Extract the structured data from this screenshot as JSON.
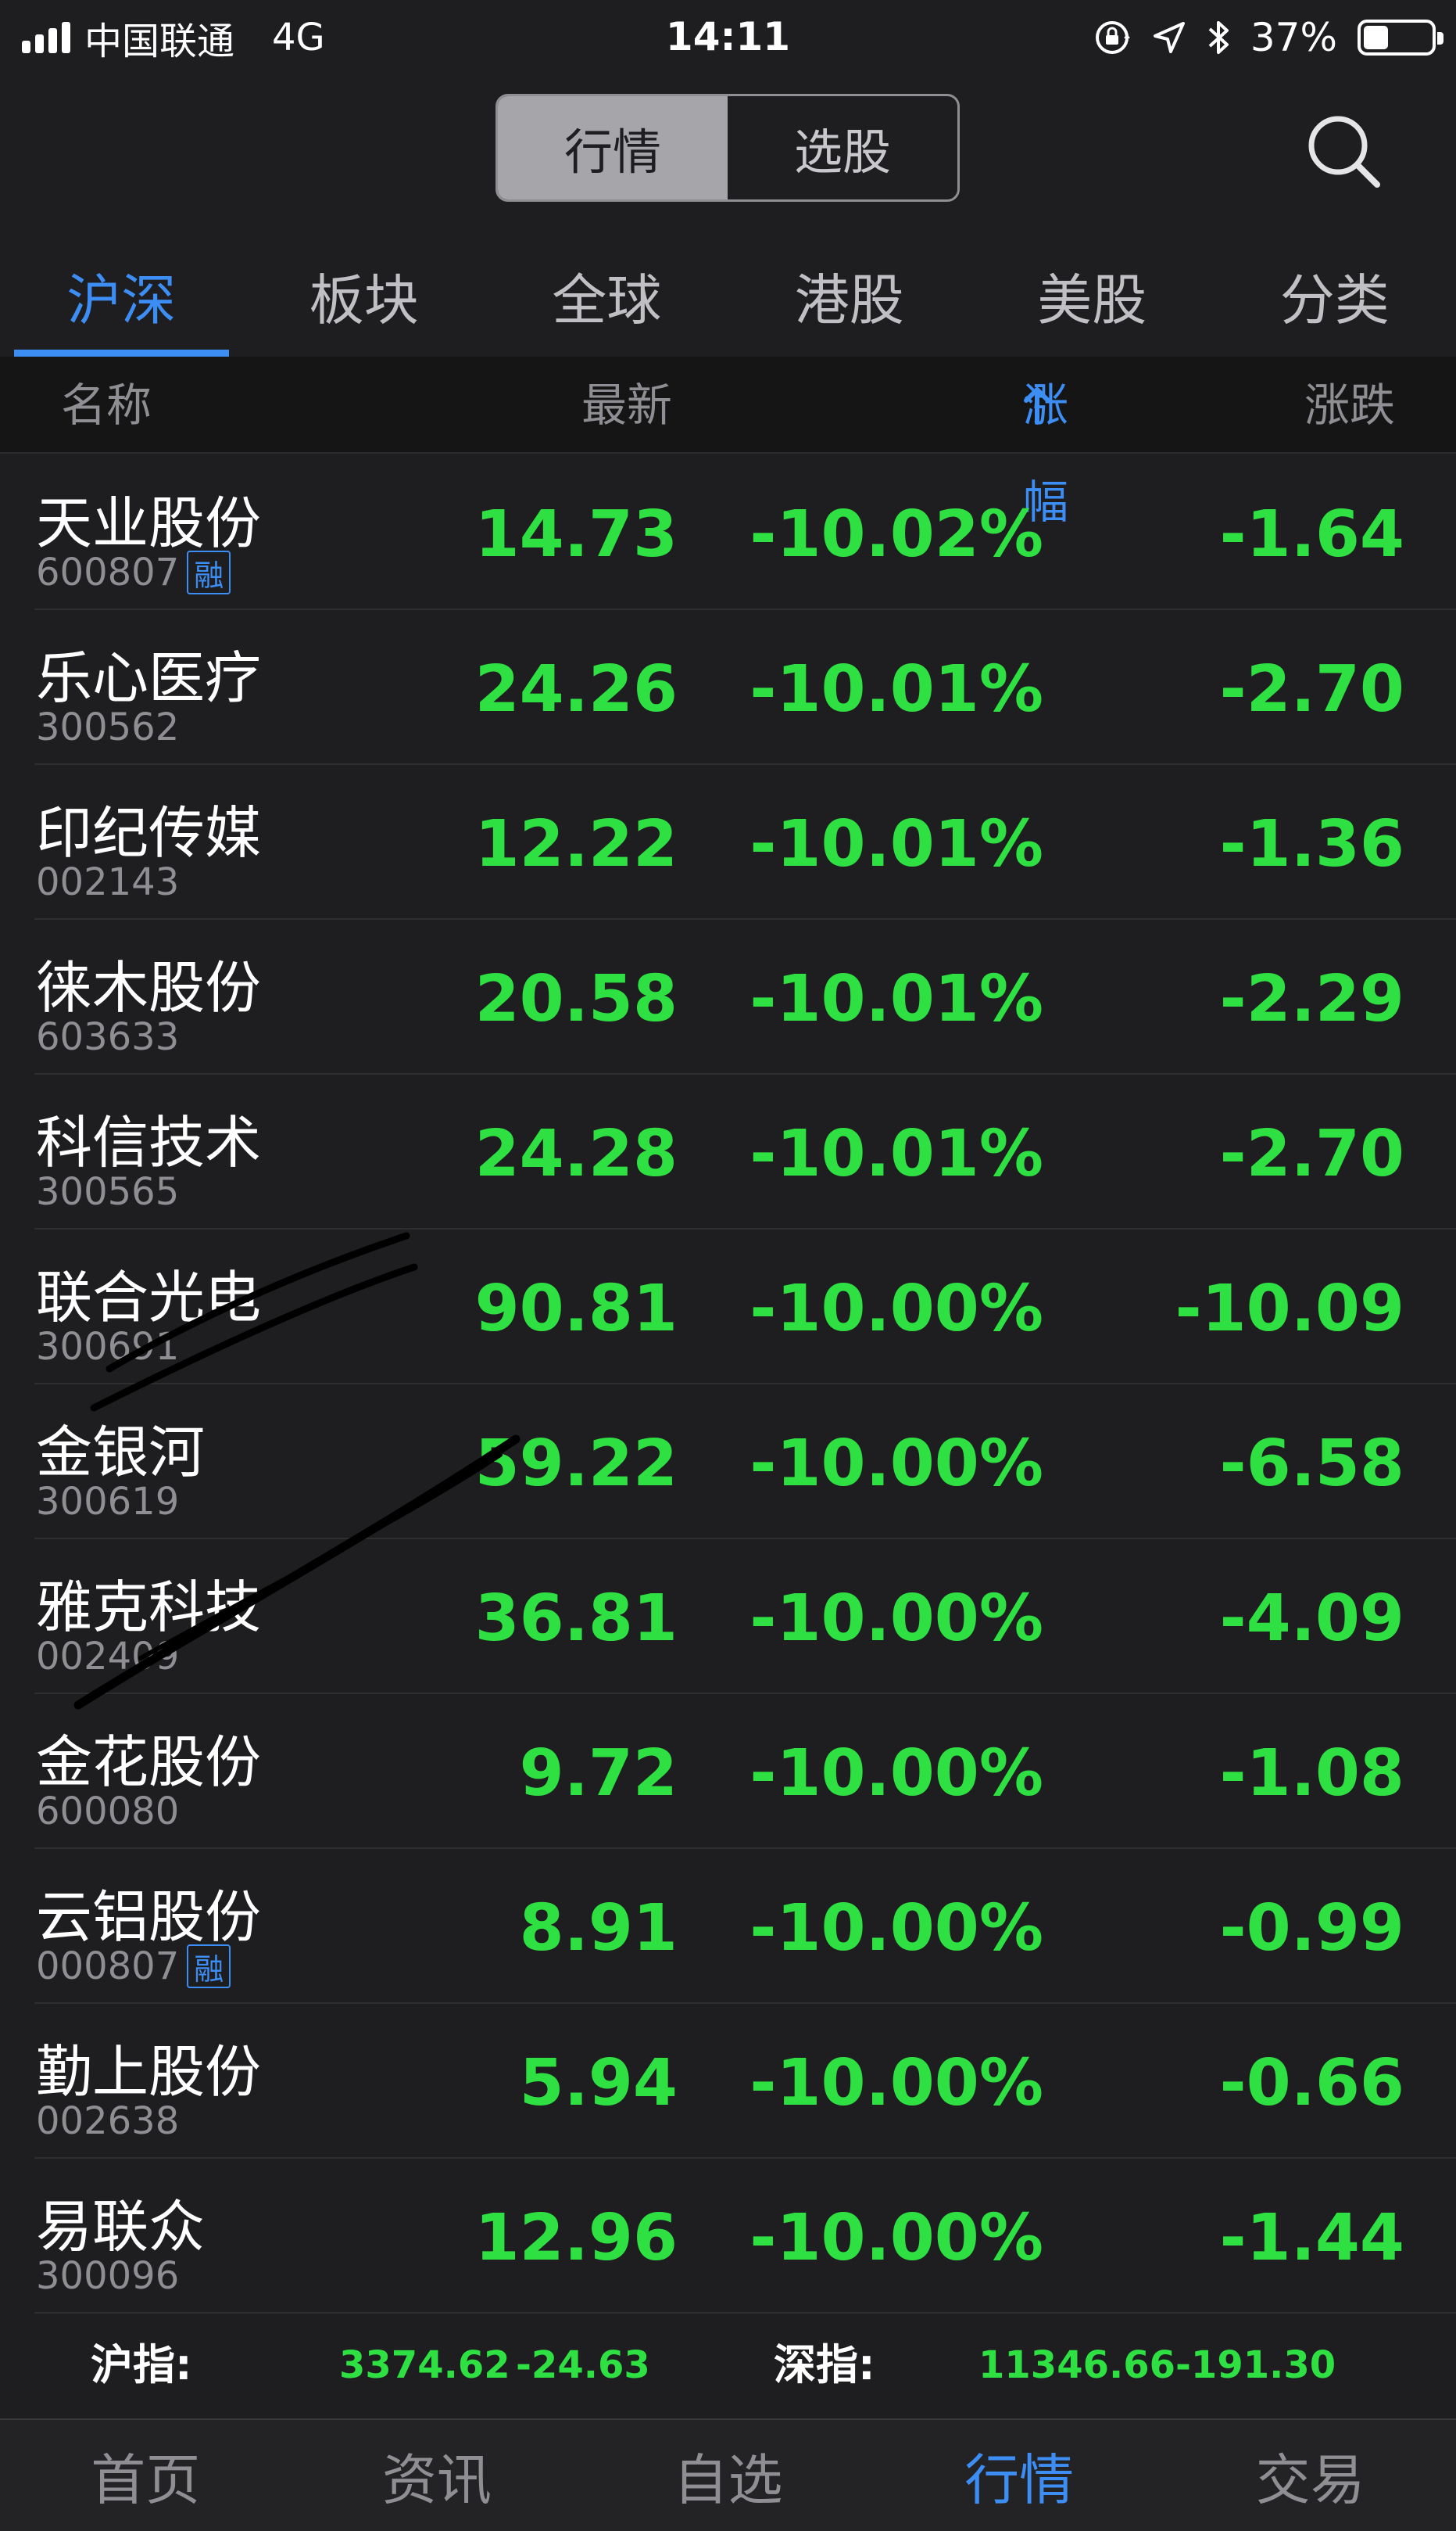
{
  "status_bar": {
    "carrier": "中国联通",
    "network": "4G",
    "time": "14:11",
    "battery_percent": "37%",
    "battery_level": 0.37,
    "icons": [
      "signal-icon",
      "rotation-lock-icon",
      "location-icon",
      "bluetooth-icon",
      "battery-icon"
    ]
  },
  "top_segment": {
    "tabs": [
      {
        "label": "行情",
        "active": true
      },
      {
        "label": "选股",
        "active": false
      }
    ],
    "search_icon": "search-icon"
  },
  "market_tabs": [
    {
      "label": "沪深",
      "active": true
    },
    {
      "label": "板块",
      "active": false
    },
    {
      "label": "全球",
      "active": false
    },
    {
      "label": "港股",
      "active": false
    },
    {
      "label": "美股",
      "active": false
    },
    {
      "label": "分类",
      "active": false
    }
  ],
  "columns": {
    "name": "名称",
    "price": "最新",
    "pct": "涨幅",
    "pct_sort_icon": "arrow-up-icon",
    "change": "涨跌"
  },
  "stocks": [
    {
      "name": "天业股份",
      "code": "600807",
      "margin": "融",
      "price": "14.73",
      "pct": "-10.02%",
      "change": "-1.64"
    },
    {
      "name": "乐心医疗",
      "code": "300562",
      "margin": "",
      "price": "24.26",
      "pct": "-10.01%",
      "change": "-2.70"
    },
    {
      "name": "印纪传媒",
      "code": "002143",
      "margin": "",
      "price": "12.22",
      "pct": "-10.01%",
      "change": "-1.36"
    },
    {
      "name": "徕木股份",
      "code": "603633",
      "margin": "",
      "price": "20.58",
      "pct": "-10.01%",
      "change": "-2.29"
    },
    {
      "name": "科信技术",
      "code": "300565",
      "margin": "",
      "price": "24.28",
      "pct": "-10.01%",
      "change": "-2.70"
    },
    {
      "name": "联合光电",
      "code": "300691",
      "margin": "",
      "price": "90.81",
      "pct": "-10.00%",
      "change": "-10.09"
    },
    {
      "name": "金银河",
      "code": "300619",
      "margin": "",
      "price": "59.22",
      "pct": "-10.00%",
      "change": "-6.58"
    },
    {
      "name": "雅克科技",
      "code": "002409",
      "margin": "",
      "price": "36.81",
      "pct": "-10.00%",
      "change": "-4.09"
    },
    {
      "name": "金花股份",
      "code": "600080",
      "margin": "",
      "price": "9.72",
      "pct": "-10.00%",
      "change": "-1.08"
    },
    {
      "name": "云铝股份",
      "code": "000807",
      "margin": "融",
      "price": "8.91",
      "pct": "-10.00%",
      "change": "-0.99"
    },
    {
      "name": "勤上股份",
      "code": "002638",
      "margin": "",
      "price": "5.94",
      "pct": "-10.00%",
      "change": "-0.66"
    },
    {
      "name": "易联众",
      "code": "300096",
      "margin": "",
      "price": "12.96",
      "pct": "-10.00%",
      "change": "-1.44"
    }
  ],
  "index_bar": {
    "sh_label": "沪指:",
    "sh_value": "3374.62",
    "sh_change": "-24.63",
    "sz_label": "深指:",
    "sz_value": "11346.66",
    "sz_change": "-191.30"
  },
  "bottom_tabs": [
    {
      "label": "首页",
      "active": false
    },
    {
      "label": "资讯",
      "active": false
    },
    {
      "label": "自选",
      "active": false
    },
    {
      "label": "行情",
      "active": true
    },
    {
      "label": "交易",
      "active": false
    }
  ],
  "colors": {
    "background": "#1e1e20",
    "accent": "#3d8ef4",
    "down_green": "#2ee042",
    "muted": "#8e8e93"
  }
}
